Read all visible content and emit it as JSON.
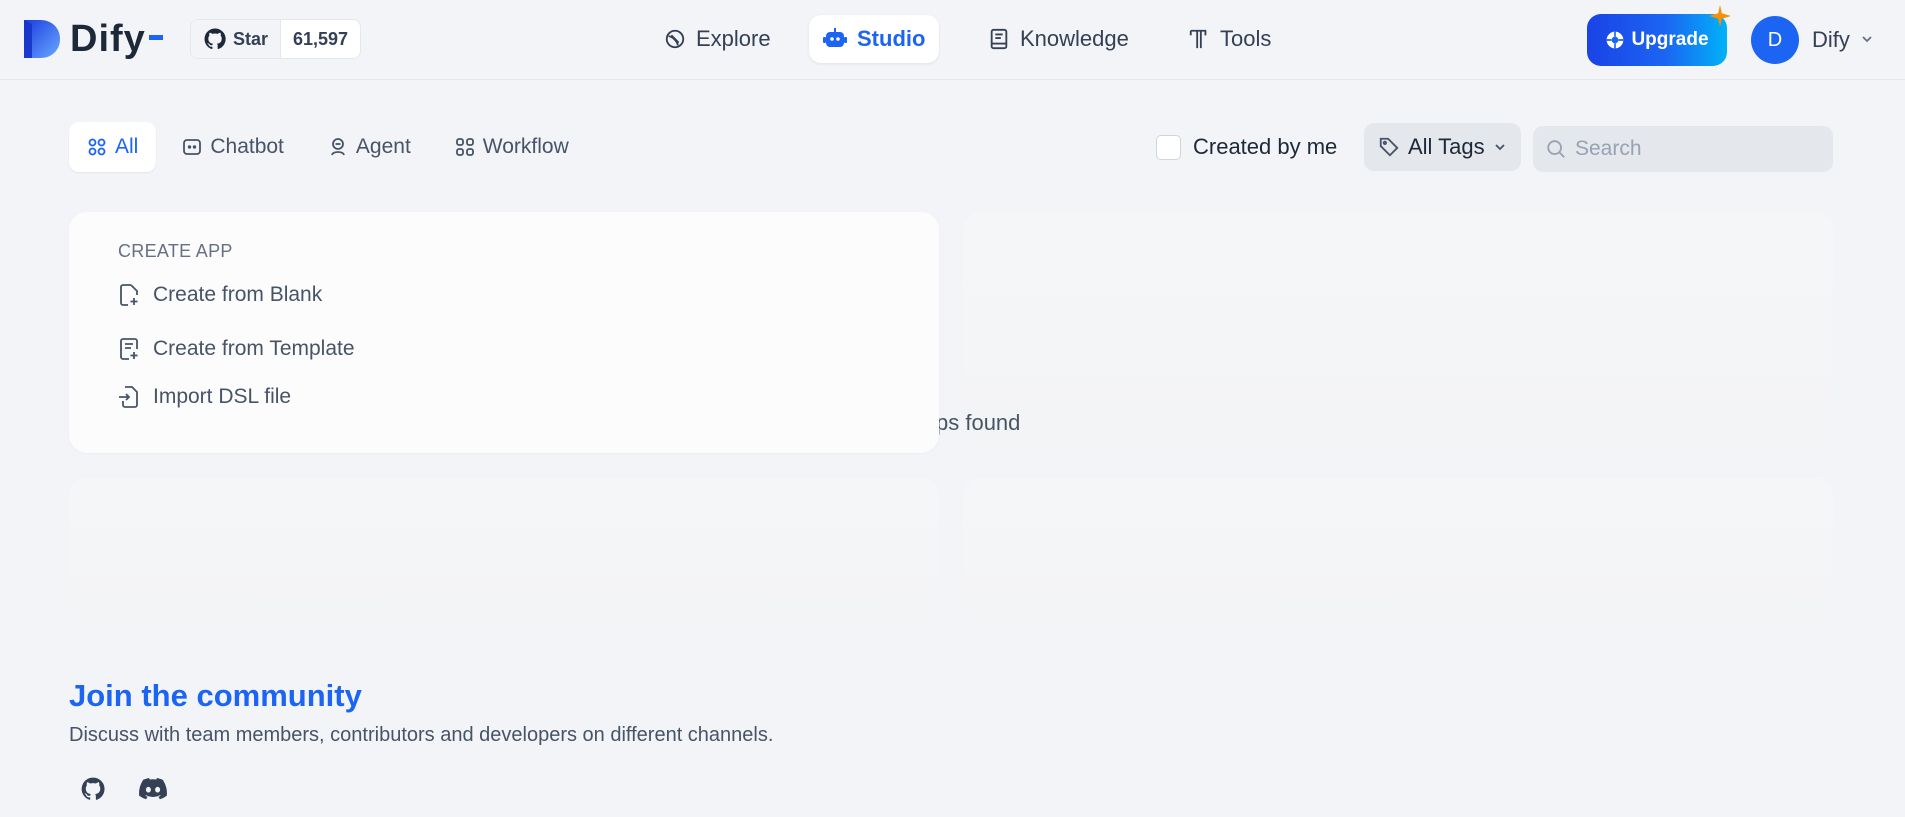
{
  "header": {
    "logo_text": "Dify",
    "github": {
      "star_label": "Star",
      "star_count": "61,597"
    },
    "nav": [
      {
        "label": "Explore",
        "icon": "compass-icon"
      },
      {
        "label": "Studio",
        "icon": "robot-icon",
        "active": true
      },
      {
        "label": "Knowledge",
        "icon": "book-icon"
      },
      {
        "label": "Tools",
        "icon": "hammer-icon"
      }
    ],
    "upgrade_label": "Upgrade",
    "user": {
      "avatar_initial": "D",
      "name": "Dify"
    }
  },
  "filters": {
    "tabs": [
      {
        "label": "All",
        "icon": "grid-icon",
        "active": true
      },
      {
        "label": "Chatbot",
        "icon": "chat-bubble-icon"
      },
      {
        "label": "Agent",
        "icon": "agent-icon"
      },
      {
        "label": "Workflow",
        "icon": "workflow-icon"
      }
    ],
    "created_by_me_label": "Created by me",
    "created_by_me_checked": false,
    "tags_label": "All Tags",
    "search_placeholder": "Search",
    "search_value": ""
  },
  "create_app": {
    "title": "CREATE APP",
    "items": [
      {
        "label": "Create from Blank",
        "icon": "file-plus-icon"
      },
      {
        "label": "Create from Template",
        "icon": "template-plus-icon"
      },
      {
        "label": "Import DSL file",
        "icon": "file-import-icon"
      }
    ]
  },
  "empty_state_text": "ps found",
  "community": {
    "title": "Join the community",
    "description": "Discuss with team members, contributors and developers on different channels.",
    "links": [
      {
        "icon": "github-icon"
      },
      {
        "icon": "discord-icon"
      }
    ]
  },
  "colors": {
    "accent": "#1c64f2",
    "background": "#f2f4f7",
    "text": "#344054"
  }
}
